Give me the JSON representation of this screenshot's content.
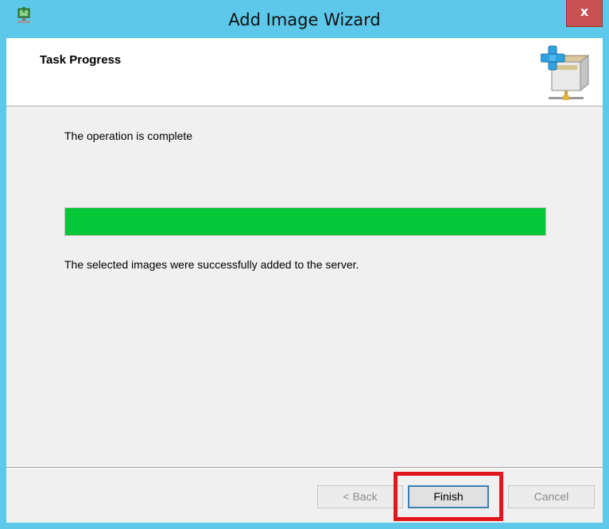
{
  "window": {
    "title": "Add Image Wizard",
    "close_label": "x",
    "app_icon": "wizard-app-icon"
  },
  "header": {
    "title": "Task Progress",
    "icon": "add-image-box-icon"
  },
  "content": {
    "status": "The operation is complete",
    "progress_percent": 100,
    "result": "The selected images were successfully added to the server."
  },
  "buttons": {
    "back": "< Back",
    "finish": "Finish",
    "cancel": "Cancel"
  },
  "colors": {
    "titlebar": "#5ec8ea",
    "progress_fill": "#06c737",
    "highlight": "#e2161d"
  }
}
